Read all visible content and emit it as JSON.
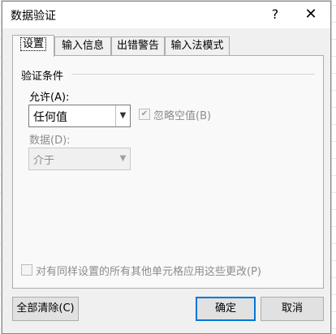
{
  "dialog": {
    "title": "数据验证",
    "help_glyph": "?",
    "close_glyph": "✕"
  },
  "tabs": [
    {
      "label": "设置",
      "active": true
    },
    {
      "label": "输入信息",
      "active": false
    },
    {
      "label": "出错警告",
      "active": false
    },
    {
      "label": "输入法模式",
      "active": false
    }
  ],
  "settings": {
    "group_title": "验证条件",
    "allow_label": "允许(A):",
    "allow_value": "任何值",
    "ignore_blank_label": "忽略空值(B)",
    "ignore_blank_checked": true,
    "data_label": "数据(D):",
    "data_value": "介于",
    "apply_all_label": "对有同样设置的所有其他单元格应用这些更改(P)",
    "apply_all_checked": false
  },
  "buttons": {
    "clear_all": "全部清除(C)",
    "ok": "确定",
    "cancel": "取消"
  }
}
